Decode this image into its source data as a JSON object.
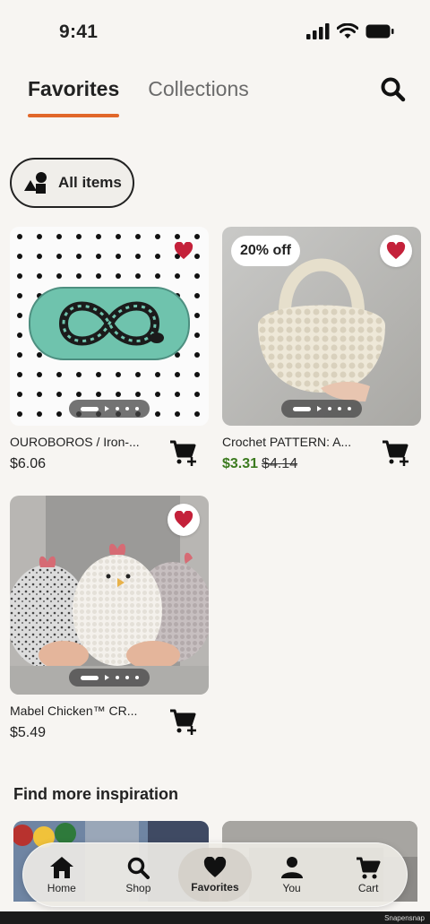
{
  "status_bar": {
    "time": "9:41"
  },
  "tabs": [
    {
      "label": "Favorites",
      "active": true
    },
    {
      "label": "Collections",
      "active": false
    }
  ],
  "filter": {
    "label": "All items"
  },
  "items": [
    {
      "title": "OUROBOROS / Iron-...",
      "price": "$6.06",
      "favorited": true
    },
    {
      "title": "Crochet PATTERN: A...",
      "sale_price": "$3.31",
      "original_price": "$4.14",
      "badge": "20% off",
      "favorited": true
    },
    {
      "title": "Mabel Chicken™ CR...",
      "price": "$5.49",
      "favorited": true
    }
  ],
  "section": {
    "title": "Find more inspiration"
  },
  "bottom_nav": [
    {
      "label": "Home",
      "icon": "home-icon"
    },
    {
      "label": "Shop",
      "icon": "search-icon"
    },
    {
      "label": "Favorites",
      "icon": "heart-icon",
      "active": true
    },
    {
      "label": "You",
      "icon": "person-icon"
    },
    {
      "label": "Cart",
      "icon": "cart-icon"
    }
  ],
  "watermark": "Snapensnap",
  "colors": {
    "accent": "#e1672a",
    "heart": "#c4213a",
    "sale": "#3b7a1e"
  }
}
